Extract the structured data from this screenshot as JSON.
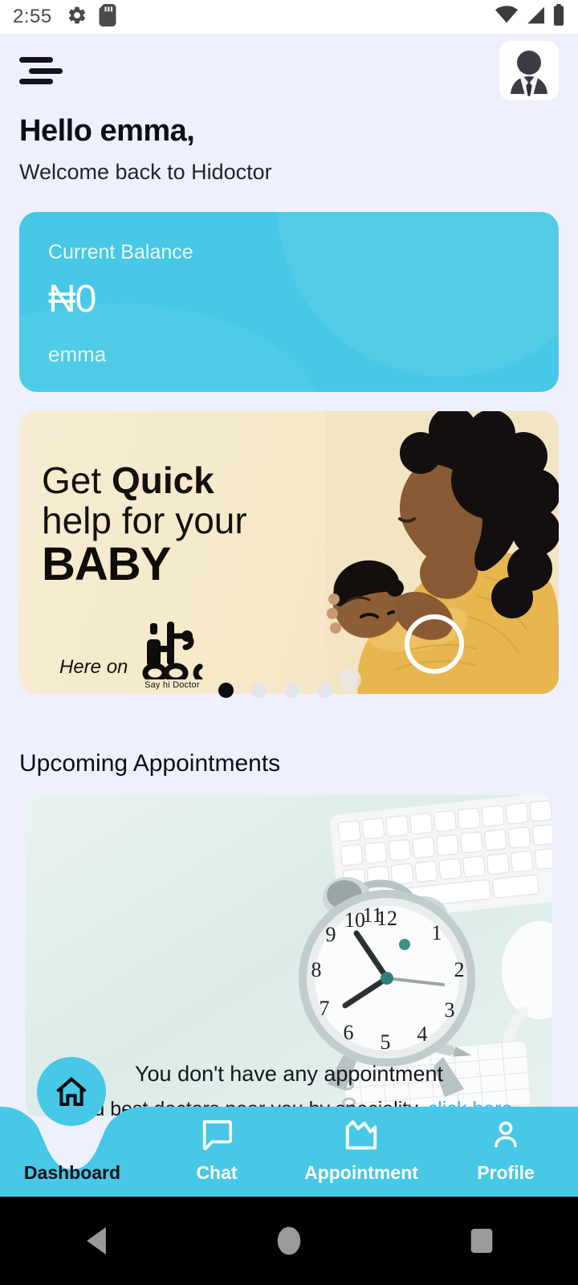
{
  "status_bar": {
    "time": "2:55",
    "left_icons": [
      "settings-gear-icon",
      "sd-card-icon"
    ],
    "right_icons": [
      "wifi-icon",
      "cellular-signal-icon",
      "battery-icon"
    ]
  },
  "header": {
    "menu_icon": "hamburger-menu-icon",
    "avatar_icon": "user-avatar-placeholder",
    "greeting": "Hello emma,",
    "subtitle": "Welcome back to Hidoctor"
  },
  "balance_card": {
    "label": "Current Balance",
    "amount": "₦0",
    "account_name": "emma",
    "color": "#46c8e6"
  },
  "promo_banner": {
    "line1_plain": "Get ",
    "line1_bold": "Quick",
    "line2": "help for your",
    "line3": "BABY",
    "here_on": "Here on",
    "logo_caption": "Say hi Doctor",
    "background_color": "#f6e9ca",
    "dots": [
      {
        "active": true
      },
      {
        "active": false
      },
      {
        "active": false
      },
      {
        "active": false
      }
    ]
  },
  "appointments": {
    "section_title": "Upcoming Appointments",
    "empty_title": "You don't have any appointment",
    "empty_subtitle": "Find best doctors near you by speciality,",
    "empty_link": "click here",
    "link_color": "#3fa9f5"
  },
  "bottom_nav": {
    "accent": "#46c8e6",
    "items": [
      {
        "label": "Dashboard",
        "icon": "home-icon",
        "active": true
      },
      {
        "label": "Chat",
        "icon": "chat-bubble-icon",
        "active": false
      },
      {
        "label": "Appointment",
        "icon": "calendar-image-icon",
        "active": false
      },
      {
        "label": "Profile",
        "icon": "person-icon",
        "active": false
      }
    ]
  },
  "android_nav": {
    "back": "back-triangle-icon",
    "home": "home-circle-icon",
    "recents": "recents-square-icon"
  }
}
